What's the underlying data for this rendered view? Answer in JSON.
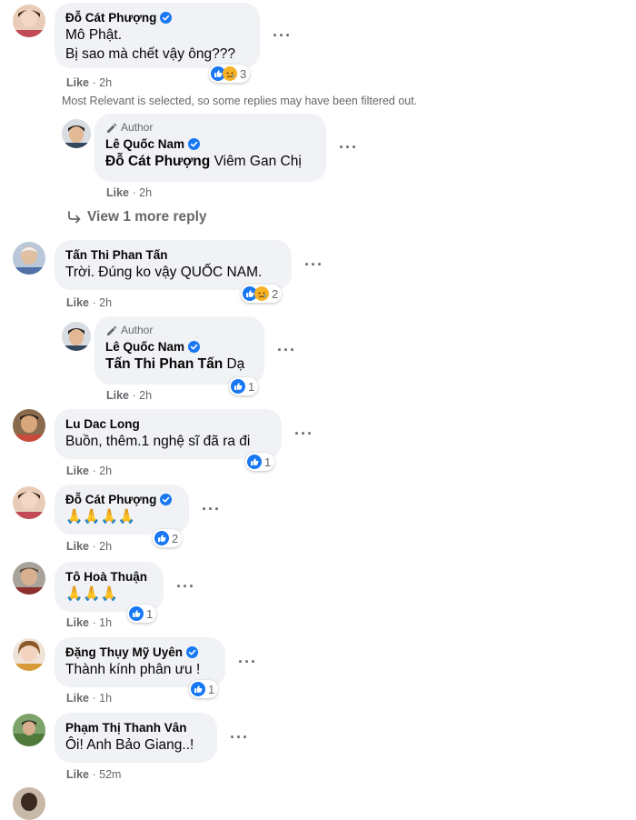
{
  "note_filtered": "Most Relevant is selected, so some replies may have been filtered out.",
  "view_more": "View 1 more reply",
  "author_badge": "Author",
  "like_label": "Like",
  "comments": [
    {
      "author": "Đỗ Cát Phượng",
      "lines": [
        "Mô Phật.",
        "Bị sao mà chết vậy ông???"
      ],
      "time": "2h",
      "reactions": "3"
    },
    {
      "author": "Lê Quốc Nam",
      "mention": "Đỗ Cát Phượng",
      "text": "Viêm Gan Chị",
      "time": "2h"
    },
    {
      "author": "Tấn Thi Phan Tấn",
      "text": "Trời. Đúng ko vậy QUỐC NAM.",
      "time": "2h",
      "reactions": "2"
    },
    {
      "author": "Lê Quốc Nam",
      "mention": "Tấn Thi Phan Tấn",
      "text": "Dạ",
      "time": "2h",
      "reactions": "1"
    },
    {
      "author": "Lu Dac Long",
      "text": "Buồn, thêm.1 nghệ sĩ đã ra đi",
      "time": "2h",
      "reactions": "1"
    },
    {
      "author": "Đỗ Cát Phượng",
      "text": "🙏🙏🙏🙏",
      "time": "2h",
      "reactions": "2"
    },
    {
      "author": "Tô Hoà Thuận",
      "text": "🙏🙏🙏",
      "time": "1h",
      "reactions": "1"
    },
    {
      "author": "Đặng Thụy Mỹ Uyên",
      "text": "Thành kính phân ưu !",
      "time": "1h",
      "reactions": "1"
    },
    {
      "author": "Phạm Thị Thanh Vân",
      "text": "Ôi! Anh Bảo Giang..!",
      "time": "52m"
    }
  ],
  "colors": {
    "bubble": "#f0f2f5",
    "like_blue": "#1877f2",
    "meta": "#65676b"
  }
}
